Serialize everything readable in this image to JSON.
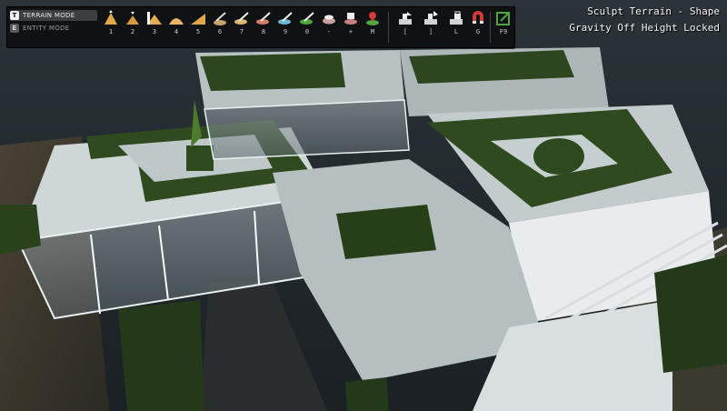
{
  "toolbar": {
    "modes": [
      {
        "key": "T",
        "label": "TERRAIN MODE",
        "active": true
      },
      {
        "key": "E",
        "label": "ENTITY MODE",
        "active": false
      }
    ],
    "tools": [
      {
        "name": "raise-tool",
        "hotkey": "1"
      },
      {
        "name": "lower-tool",
        "hotkey": "2"
      },
      {
        "name": "flatten-tool",
        "hotkey": "3"
      },
      {
        "name": "smooth-tool",
        "hotkey": "4"
      },
      {
        "name": "ramp-tool",
        "hotkey": "5"
      },
      {
        "name": "shovel-tool",
        "hotkey": "6"
      },
      {
        "name": "paint-sand-tool",
        "hotkey": "7"
      },
      {
        "name": "paint-clay-tool",
        "hotkey": "8"
      },
      {
        "name": "paint-water-tool",
        "hotkey": "9"
      },
      {
        "name": "paint-grass-tool",
        "hotkey": "0"
      },
      {
        "name": "decrease-size-tool",
        "hotkey": "-"
      },
      {
        "name": "increase-size-tool",
        "hotkey": "+"
      },
      {
        "name": "marker-tool",
        "hotkey": "M"
      }
    ],
    "options": [
      {
        "name": "brush-smaller-option",
        "hotkey": "["
      },
      {
        "name": "brush-larger-option",
        "hotkey": "]"
      },
      {
        "name": "height-lock-option",
        "hotkey": "L"
      },
      {
        "name": "gravity-magnet-option",
        "hotkey": "G"
      }
    ],
    "exit": {
      "name": "exit-editor-button",
      "hotkey": "F9"
    }
  },
  "status": {
    "line1": "Sculpt Terrain - Shape",
    "line2": "Gravity Off Height Locked"
  },
  "colors": {
    "hedge": "#2f4a1f",
    "concrete": "#cfd6d6",
    "accent_red": "#d23a3a"
  }
}
